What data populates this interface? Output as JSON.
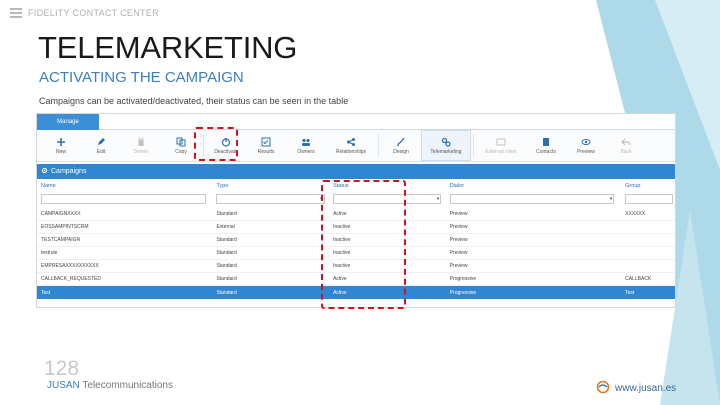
{
  "header": {
    "label": "FIDELITY CONTACT CENTER",
    "menu_icon": "hamburger-icon"
  },
  "slide": {
    "title": "TELEMARKETING",
    "subtitle": "ACTIVATING THE CAMPAIGN",
    "description": "Campaigns can be activated/deactivated, their status can be seen in the table",
    "page_number": "128",
    "company_brand": "JUSAN",
    "company_rest": " Telecommunications",
    "website": "www.jusan.es"
  },
  "colors": {
    "accent_blue": "#2f86d3",
    "highlight_red": "#d0141c",
    "deco_blue": "#aed9e8"
  },
  "app": {
    "tab_label": "Manage",
    "toolbar": [
      {
        "label": "New",
        "icon": "plus-icon",
        "dim": false
      },
      {
        "label": "Edit",
        "icon": "pencil-icon",
        "dim": false
      },
      {
        "label": "Delete",
        "icon": "trash-icon",
        "dim": true
      },
      {
        "label": "Copy",
        "icon": "copy-icon",
        "dim": false
      },
      {
        "label": "Deactivate",
        "icon": "power-icon",
        "dim": false
      },
      {
        "label": "Results",
        "icon": "checklist-icon",
        "dim": false
      },
      {
        "label": "Owners",
        "icon": "users-icon",
        "dim": false
      },
      {
        "label": "Relationships",
        "icon": "relationships-icon",
        "dim": false
      },
      {
        "label": "Design",
        "icon": "brush-icon",
        "dim": false
      },
      {
        "label": "Telemarketing",
        "icon": "gears-icon",
        "dim": false
      },
      {
        "label": "External client",
        "icon": "external-icon",
        "dim": true
      },
      {
        "label": "Contacts",
        "icon": "book-icon",
        "dim": false
      },
      {
        "label": "Preview",
        "icon": "eye-icon",
        "dim": false
      },
      {
        "label": "Back",
        "icon": "back-icon",
        "dim": true
      }
    ],
    "panel_title": "Campaigns",
    "columns": [
      "Name",
      "Type",
      "Status",
      "Dialer",
      "Group"
    ],
    "rows": [
      {
        "name": "CAMPAIGNXXXX",
        "type": "Standard",
        "status": "Active",
        "dialer": "Preview",
        "group": "XXXXXX"
      },
      {
        "name": "EOSSAMPINTSCRM",
        "type": "External",
        "status": "Inactive",
        "dialer": "Preview",
        "group": ""
      },
      {
        "name": "TESTCAMPAIGN",
        "type": "Standard",
        "status": "Inactive",
        "dialer": "Preview",
        "group": ""
      },
      {
        "name": "testrule",
        "type": "Standard",
        "status": "Inactive",
        "dialer": "Preview",
        "group": ""
      },
      {
        "name": "EMPRESAXXXXXXXXXX",
        "type": "Standard",
        "status": "Inactive",
        "dialer": "Preview",
        "group": ""
      },
      {
        "name": "CALLBACK_REQUESTED",
        "type": "Standard",
        "status": "Active",
        "dialer": "Progressive",
        "group": "CALLBACK"
      },
      {
        "name": "Test",
        "type": "Standard",
        "status": "Active",
        "dialer": "Progressive",
        "group": "Test",
        "selected": true
      }
    ]
  }
}
